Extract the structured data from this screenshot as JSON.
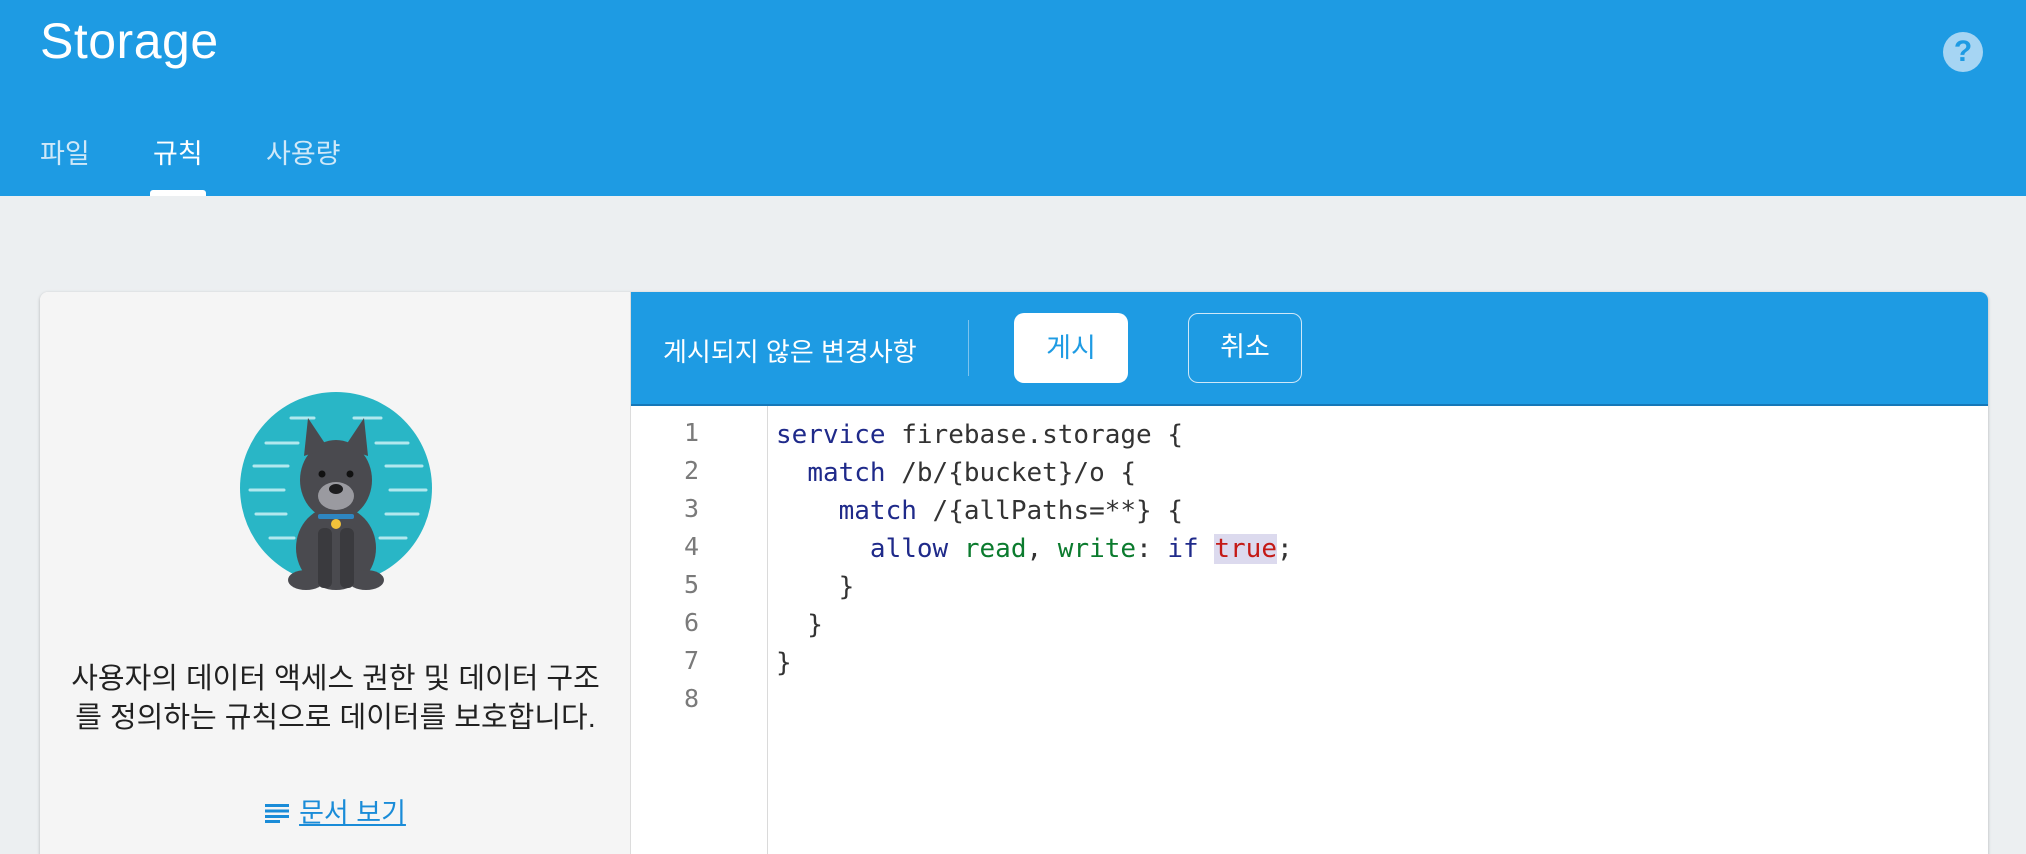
{
  "header": {
    "title": "Storage",
    "help_icon": "help-circle-icon",
    "tabs": [
      {
        "label": "파일",
        "active": false
      },
      {
        "label": "규칙",
        "active": true
      },
      {
        "label": "사용량",
        "active": false
      }
    ]
  },
  "left_panel": {
    "illustration": "dog-guard-illustration",
    "description": "사용자의 데이터 액세스 권한 및 데이터 구조를 정의하는 규칙으로 데이터를 보호합니다.",
    "doc_link": "문서 보기",
    "doc_icon": "document-lines-icon"
  },
  "toolbar": {
    "status": "게시되지 않은 변경사항",
    "publish_label": "게시",
    "cancel_label": "취소"
  },
  "editor": {
    "line_numbers": [
      "1",
      "2",
      "3",
      "4",
      "5",
      "6",
      "7",
      "8"
    ],
    "lines": [
      "service firebase.storage {",
      "  match /b/{bucket}/o {",
      "    match /{allPaths=**} {",
      "      allow read, write: if true;",
      "    }",
      "  }",
      "}",
      ""
    ]
  },
  "colors": {
    "header_blue": "#1e9be3",
    "page_bg": "#eceff1",
    "keyword": "#1f2a8a",
    "permission": "#0b7b2e",
    "boolean": "#c41a16"
  }
}
